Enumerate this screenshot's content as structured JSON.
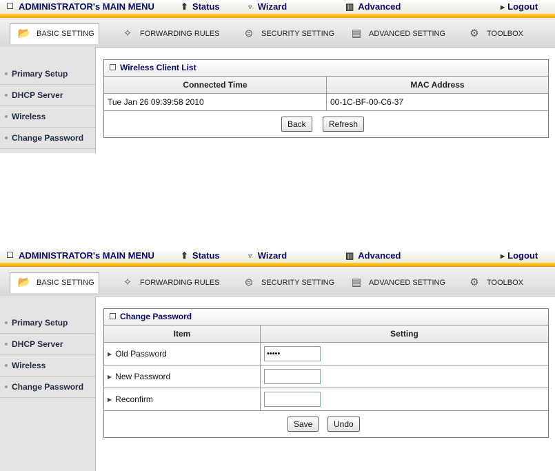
{
  "topmenu": {
    "admin": "ADMINISTRATOR's MAIN MENU",
    "status": "Status",
    "wizard": "Wizard",
    "advanced": "Advanced",
    "logout": "Logout"
  },
  "tabs": {
    "basic": "BASIC SETTING",
    "forwarding": "FORWARDING RULES",
    "security": "SECURITY SETTING",
    "advanced": "ADVANCED SETTING",
    "toolbox": "TOOLBOX"
  },
  "sidebar": {
    "items": [
      "Primary Setup",
      "DHCP Server",
      "Wireless",
      "Change Password"
    ]
  },
  "wireless_list": {
    "title": "Wireless Client List",
    "headers": [
      "Connected Time",
      "MAC Address"
    ],
    "rows": [
      {
        "time": "Tue Jan 26 09:39:58 2010",
        "mac": "00-1C-BF-00-C6-37"
      }
    ],
    "back_label": "Back",
    "refresh_label": "Refresh"
  },
  "change_password": {
    "title": "Change Password",
    "headers": [
      "Item",
      "Setting"
    ],
    "rows": [
      {
        "label": "Old Password",
        "value": "•••••"
      },
      {
        "label": "New Password",
        "value": ""
      },
      {
        "label": "Reconfirm",
        "value": ""
      }
    ],
    "save_label": "Save",
    "undo_label": "Undo"
  },
  "colors": {
    "accent_bar": "#ffb000",
    "menu_text": "#0a0a6a",
    "sidebar_bg": "#e4e4e4"
  }
}
